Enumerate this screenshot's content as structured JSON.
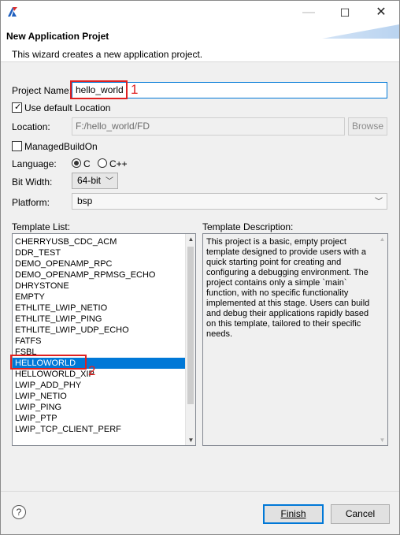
{
  "window": {
    "title": "",
    "controls": {
      "minimize": "—",
      "maximize": "☐",
      "close": "✕"
    }
  },
  "header": {
    "title": "New Application Projet",
    "description": "This wizard creates a new application project."
  },
  "form": {
    "project_name_label": "Project Name:",
    "project_name_value": "hello_world",
    "use_default_location_label": "Use default Location",
    "use_default_location_checked": true,
    "location_label": "Location:",
    "location_value": "F:/hello_world/FD",
    "browse_label": "Browse",
    "managed_build_label": "ManagedBuildOn",
    "managed_build_checked": false,
    "language_label": "Language:",
    "language_options": [
      "C",
      "C++"
    ],
    "language_selected": "C",
    "bit_width_label": "Bit Width:",
    "bit_width_value": "64-bit",
    "platform_label": "Platform:",
    "platform_value": "bsp"
  },
  "templates": {
    "list_label": "Template List:",
    "description_label": "Template Description:",
    "items": [
      "CHERRYUSB_CDC_ACM",
      "DDR_TEST",
      "DEMO_OPENAMP_RPC",
      "DEMO_OPENAMP_RPMSG_ECHO",
      "DHRYSTONE",
      "EMPTY",
      "ETHLITE_LWIP_NETIO",
      "ETHLITE_LWIP_PING",
      "ETHLITE_LWIP_UDP_ECHO",
      "FATFS",
      "FSBL",
      "HELLOWORLD",
      "HELLOWORLD_XIP",
      "LWIP_ADD_PHY",
      "LWIP_NETIO",
      "LWIP_PING",
      "LWIP_PTP",
      "LWIP_TCP_CLIENT_PERF"
    ],
    "selected": "HELLOWORLD",
    "description": "This project is a basic, empty project template designed to provide users with a quick starting point for creating and configuring a debugging environment. The project contains only a simple `main` function, with no specific functionality implemented at this stage. Users can build and debug their applications rapidly based on this template, tailored to their specific needs."
  },
  "annotations": {
    "first": "1",
    "second": "2"
  },
  "footer": {
    "help_glyph": "?",
    "finish_label": "Finish",
    "cancel_label": "Cancel"
  },
  "icons": {
    "app": "app-logo-icon",
    "help": "help-icon",
    "dropdown": "chevron-down-icon"
  },
  "colors": {
    "selection": "#0078d7",
    "annotation": "#e02020",
    "focus_border": "#0078d7"
  }
}
